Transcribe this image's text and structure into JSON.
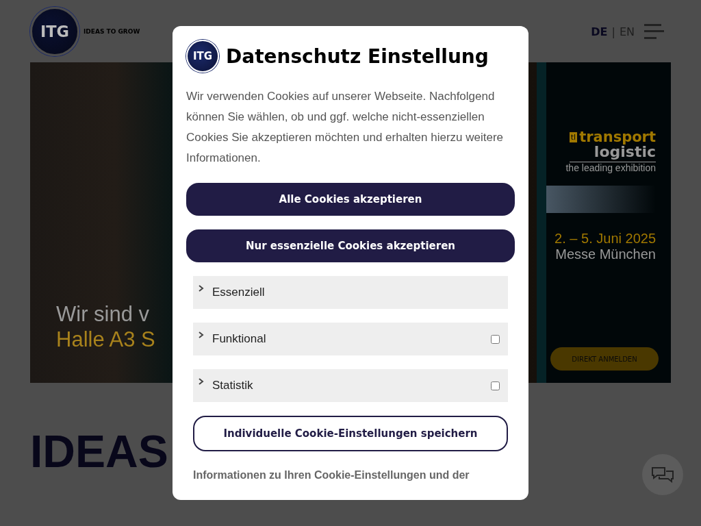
{
  "header": {
    "logo_text": "ITG",
    "tagline": "IDEAS TO GROW",
    "languages": [
      {
        "label": "DE",
        "selected": true
      },
      {
        "label": "EN",
        "selected": false
      }
    ],
    "separator": "|"
  },
  "banner": {
    "left_lines": [
      "Wir sind v",
      "Halle A3  S"
    ],
    "ad": {
      "logo_mark": "tl",
      "logo_word_1": "transport",
      "logo_word_2": "logistic",
      "slogan": "the leading exhibition",
      "date": "2. – 5. Juni 2025",
      "place": "Messe München",
      "button": "DIREKT ANMELDEN"
    }
  },
  "hero": {
    "heading": "IDEAS"
  },
  "cookie_dialog": {
    "logo_text": "ITG",
    "title": "Datenschutz Einstellung",
    "intro": "Wir verwenden Cookies auf unserer Webseite. Nachfolgend können Sie wählen, ob und ggf. welche nicht-essenziellen Cookies Sie akzeptieren möchten und erhalten hierzu weitere Informationen.",
    "primary_buttons": [
      "Alle Cookies akzeptieren",
      "Nur essenzielle Cookies akzeptieren"
    ],
    "categories": [
      {
        "kind": "required",
        "label": "Essenziell",
        "expanded": false
      },
      {
        "kind": "optional",
        "label": "Funktional",
        "expanded": false,
        "checked": false
      },
      {
        "kind": "optional",
        "label": "Statistik",
        "expanded": false,
        "checked": false
      }
    ],
    "save_button": "Individuelle Cookie-Einstellungen speichern",
    "info": "Informationen zu Ihren Cookie-Einstellungen und der"
  }
}
